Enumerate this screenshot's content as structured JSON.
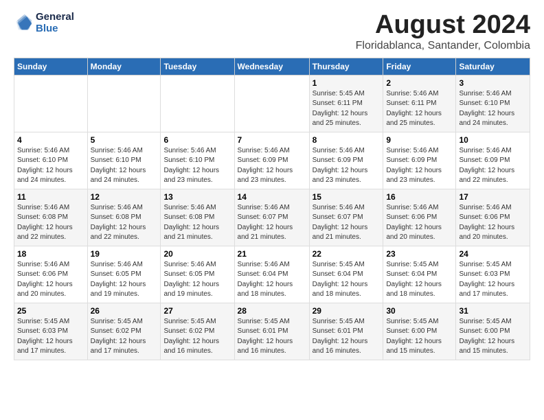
{
  "logo": {
    "line1": "General",
    "line2": "Blue"
  },
  "title": "August 2024",
  "subtitle": "Floridablanca, Santander, Colombia",
  "header": {
    "accent_color": "#2a6db5"
  },
  "days_of_week": [
    "Sunday",
    "Monday",
    "Tuesday",
    "Wednesday",
    "Thursday",
    "Friday",
    "Saturday"
  ],
  "weeks": [
    [
      {
        "day": "",
        "text": ""
      },
      {
        "day": "",
        "text": ""
      },
      {
        "day": "",
        "text": ""
      },
      {
        "day": "",
        "text": ""
      },
      {
        "day": "1",
        "text": "Sunrise: 5:45 AM\nSunset: 6:11 PM\nDaylight: 12 hours\nand 25 minutes."
      },
      {
        "day": "2",
        "text": "Sunrise: 5:46 AM\nSunset: 6:11 PM\nDaylight: 12 hours\nand 25 minutes."
      },
      {
        "day": "3",
        "text": "Sunrise: 5:46 AM\nSunset: 6:10 PM\nDaylight: 12 hours\nand 24 minutes."
      }
    ],
    [
      {
        "day": "4",
        "text": "Sunrise: 5:46 AM\nSunset: 6:10 PM\nDaylight: 12 hours\nand 24 minutes."
      },
      {
        "day": "5",
        "text": "Sunrise: 5:46 AM\nSunset: 6:10 PM\nDaylight: 12 hours\nand 24 minutes."
      },
      {
        "day": "6",
        "text": "Sunrise: 5:46 AM\nSunset: 6:10 PM\nDaylight: 12 hours\nand 23 minutes."
      },
      {
        "day": "7",
        "text": "Sunrise: 5:46 AM\nSunset: 6:09 PM\nDaylight: 12 hours\nand 23 minutes."
      },
      {
        "day": "8",
        "text": "Sunrise: 5:46 AM\nSunset: 6:09 PM\nDaylight: 12 hours\nand 23 minutes."
      },
      {
        "day": "9",
        "text": "Sunrise: 5:46 AM\nSunset: 6:09 PM\nDaylight: 12 hours\nand 23 minutes."
      },
      {
        "day": "10",
        "text": "Sunrise: 5:46 AM\nSunset: 6:09 PM\nDaylight: 12 hours\nand 22 minutes."
      }
    ],
    [
      {
        "day": "11",
        "text": "Sunrise: 5:46 AM\nSunset: 6:08 PM\nDaylight: 12 hours\nand 22 minutes."
      },
      {
        "day": "12",
        "text": "Sunrise: 5:46 AM\nSunset: 6:08 PM\nDaylight: 12 hours\nand 22 minutes."
      },
      {
        "day": "13",
        "text": "Sunrise: 5:46 AM\nSunset: 6:08 PM\nDaylight: 12 hours\nand 21 minutes."
      },
      {
        "day": "14",
        "text": "Sunrise: 5:46 AM\nSunset: 6:07 PM\nDaylight: 12 hours\nand 21 minutes."
      },
      {
        "day": "15",
        "text": "Sunrise: 5:46 AM\nSunset: 6:07 PM\nDaylight: 12 hours\nand 21 minutes."
      },
      {
        "day": "16",
        "text": "Sunrise: 5:46 AM\nSunset: 6:06 PM\nDaylight: 12 hours\nand 20 minutes."
      },
      {
        "day": "17",
        "text": "Sunrise: 5:46 AM\nSunset: 6:06 PM\nDaylight: 12 hours\nand 20 minutes."
      }
    ],
    [
      {
        "day": "18",
        "text": "Sunrise: 5:46 AM\nSunset: 6:06 PM\nDaylight: 12 hours\nand 20 minutes."
      },
      {
        "day": "19",
        "text": "Sunrise: 5:46 AM\nSunset: 6:05 PM\nDaylight: 12 hours\nand 19 minutes."
      },
      {
        "day": "20",
        "text": "Sunrise: 5:46 AM\nSunset: 6:05 PM\nDaylight: 12 hours\nand 19 minutes."
      },
      {
        "day": "21",
        "text": "Sunrise: 5:46 AM\nSunset: 6:04 PM\nDaylight: 12 hours\nand 18 minutes."
      },
      {
        "day": "22",
        "text": "Sunrise: 5:45 AM\nSunset: 6:04 PM\nDaylight: 12 hours\nand 18 minutes."
      },
      {
        "day": "23",
        "text": "Sunrise: 5:45 AM\nSunset: 6:04 PM\nDaylight: 12 hours\nand 18 minutes."
      },
      {
        "day": "24",
        "text": "Sunrise: 5:45 AM\nSunset: 6:03 PM\nDaylight: 12 hours\nand 17 minutes."
      }
    ],
    [
      {
        "day": "25",
        "text": "Sunrise: 5:45 AM\nSunset: 6:03 PM\nDaylight: 12 hours\nand 17 minutes."
      },
      {
        "day": "26",
        "text": "Sunrise: 5:45 AM\nSunset: 6:02 PM\nDaylight: 12 hours\nand 17 minutes."
      },
      {
        "day": "27",
        "text": "Sunrise: 5:45 AM\nSunset: 6:02 PM\nDaylight: 12 hours\nand 16 minutes."
      },
      {
        "day": "28",
        "text": "Sunrise: 5:45 AM\nSunset: 6:01 PM\nDaylight: 12 hours\nand 16 minutes."
      },
      {
        "day": "29",
        "text": "Sunrise: 5:45 AM\nSunset: 6:01 PM\nDaylight: 12 hours\nand 16 minutes."
      },
      {
        "day": "30",
        "text": "Sunrise: 5:45 AM\nSunset: 6:00 PM\nDaylight: 12 hours\nand 15 minutes."
      },
      {
        "day": "31",
        "text": "Sunrise: 5:45 AM\nSunset: 6:00 PM\nDaylight: 12 hours\nand 15 minutes."
      }
    ]
  ]
}
